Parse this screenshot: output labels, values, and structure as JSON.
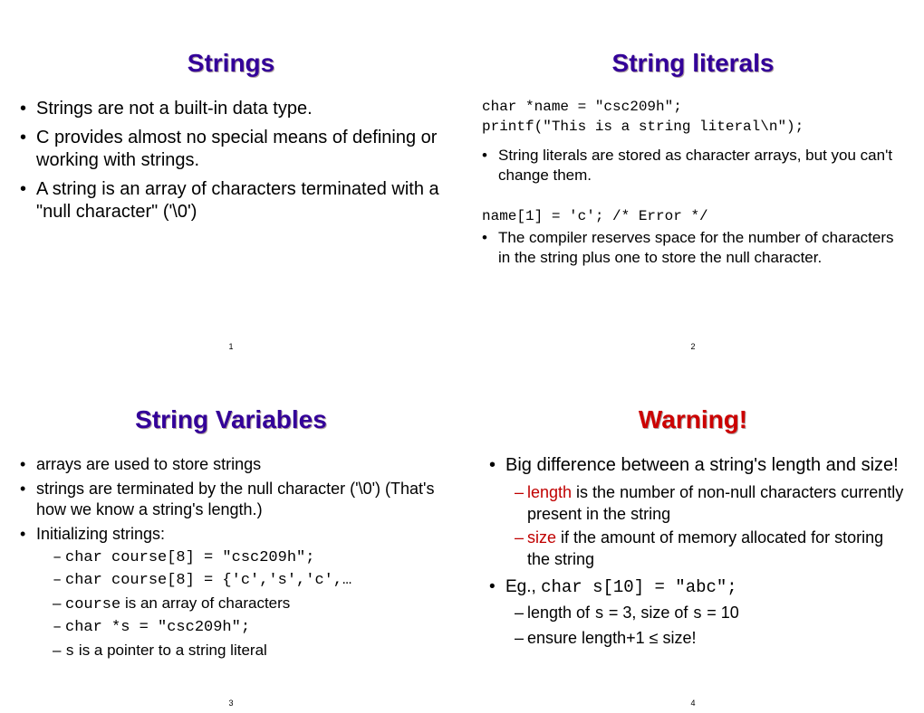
{
  "slides": [
    {
      "num": "1",
      "title": "Strings",
      "b1": "Strings are not a built-in data type.",
      "b2": "C provides almost no special means of defining or working with strings.",
      "b3": "A string is an array of characters terminated with a \"null character\" ('\\0')"
    },
    {
      "num": "2",
      "title": "String literals",
      "code1": "char *name = \"csc209h\";\nprintf(\"This is a string literal\\n\");",
      "b1": "String literals are stored as character arrays, but you can't change them.",
      "code2": "name[1] = 'c'; /* Error */",
      "b2": "The compiler reserves space for the number of characters in the string plus one to store the null character."
    },
    {
      "num": "3",
      "title": "String Variables",
      "b1": "arrays are used to store strings",
      "b2": "strings are terminated by the null character ('\\0') (That's how we know a string's length.)",
      "b3": "Initializing strings:",
      "s1": "char course[8] = \"csc209h\";",
      "s2": "char course[8] = {'c','s','c',…",
      "s3a": "course",
      "s3b": " is an array of characters",
      "s4": "char *s = \"csc209h\";",
      "s5a": "s",
      "s5b": " is a pointer to a string literal"
    },
    {
      "num": "4",
      "title": "Warning!",
      "b1": "Big difference between a string's length and size!",
      "s1a": "length",
      "s1b": " is the number of non-null characters currently present in the string",
      "s2a": "size",
      "s2b": " if the amount of memory allocated for storing the string",
      "b2a": "Eg., ",
      "b2b": "char s[10] = \"abc\";",
      "s3a": "length of ",
      "s3b": "s",
      "s3c": " = 3,  size of ",
      "s3d": "s",
      "s3e": " = 10",
      "s4": "ensure length+1 ≤ size!"
    }
  ]
}
